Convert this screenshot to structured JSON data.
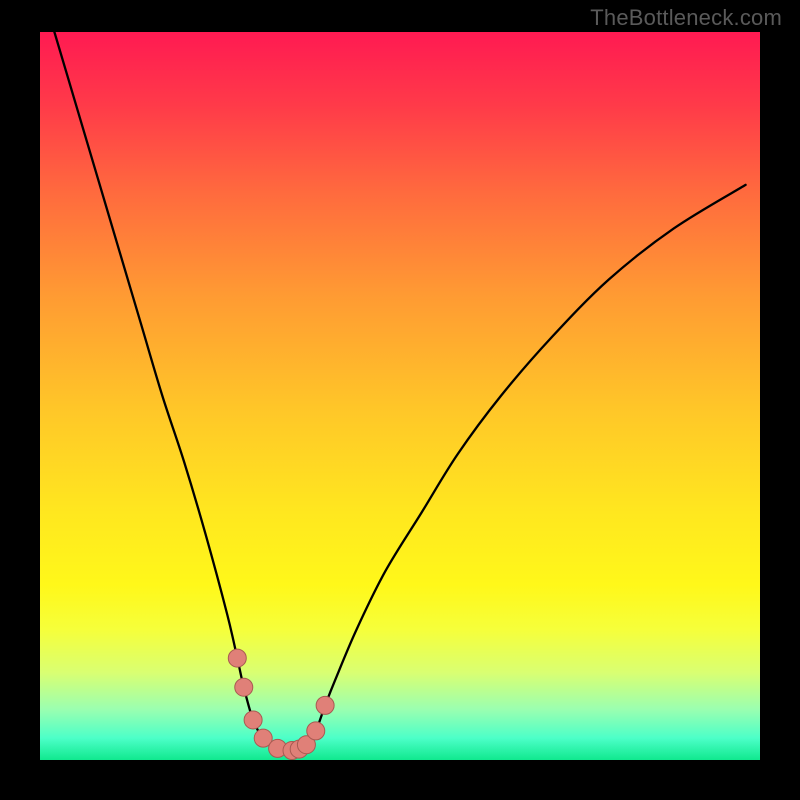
{
  "watermark": "TheBottleneck.com",
  "colors": {
    "bg_border": "#000000",
    "curve": "#000000",
    "marker_fill": "#e08078",
    "marker_stroke": "#a85a52",
    "gradient_top": "#ff1a52",
    "gradient_mid": "#ffe71f",
    "gradient_bottom": "#10e98e"
  },
  "chart_data": {
    "type": "line",
    "title": "",
    "xlabel": "",
    "ylabel": "",
    "xlim": [
      0,
      100
    ],
    "ylim": [
      0,
      100
    ],
    "grid": false,
    "legend": false,
    "annotations": [
      "TheBottleneck.com"
    ],
    "series": [
      {
        "name": "curve",
        "x": [
          2,
          5,
          8,
          11,
          14,
          17,
          20,
          23,
          26,
          27.4,
          28.3,
          29.6,
          31,
          33,
          35,
          36,
          37,
          38.3,
          39.6,
          41,
          44,
          48,
          53,
          58,
          64,
          71,
          79,
          88,
          98
        ],
        "y": [
          100,
          90,
          80,
          70,
          60,
          50,
          41,
          31,
          20,
          14,
          10,
          5.5,
          3.0,
          1.6,
          1.3,
          1.5,
          2.1,
          4.0,
          7.5,
          11,
          18,
          26,
          34,
          42,
          50,
          58,
          66,
          73,
          79
        ]
      },
      {
        "name": "markers",
        "x": [
          27.4,
          28.3,
          29.6,
          31.0,
          33.0,
          35.0,
          36.0,
          37.0,
          38.3,
          39.6
        ],
        "y": [
          14.0,
          10.0,
          5.5,
          3.0,
          1.6,
          1.3,
          1.5,
          2.1,
          4.0,
          7.5
        ]
      }
    ]
  }
}
